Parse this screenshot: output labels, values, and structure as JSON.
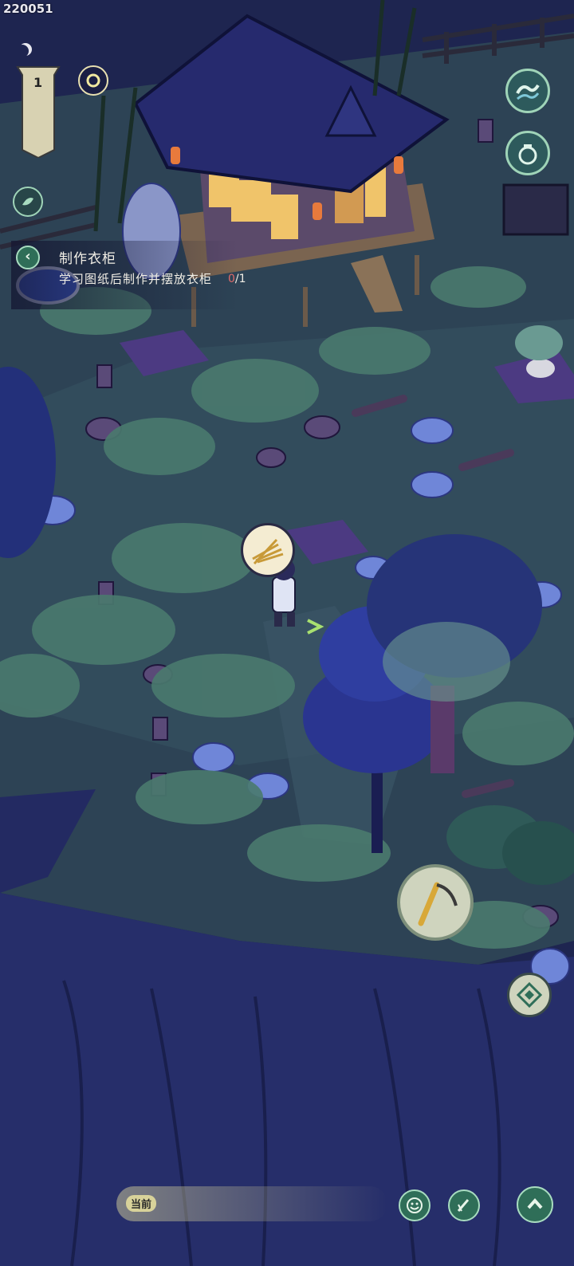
{
  "build_id": "220051",
  "level": "1",
  "quest": {
    "back_icon": "chevron-left-icon",
    "title": "制作衣柜",
    "description": "学习图纸后制作并摆放衣柜",
    "progress_current": "0",
    "progress_total": "/1"
  },
  "chat": {
    "label": "当前"
  },
  "buttons": {
    "wave_icon": "wave-icon",
    "jar_icon": "jar-icon",
    "leaf_icon": "leaf-icon",
    "compass_icon": "compass-icon",
    "scythe_icon": "scythe-icon",
    "emoji_icon": "smile-icon",
    "brush_icon": "brush-icon",
    "up_icon": "chevron-up-icon"
  },
  "colors": {
    "night_bg": "#1c2146",
    "grass": "#2f4a55",
    "accent_green": "#2f6e58",
    "progress_red": "#e06a6a"
  }
}
